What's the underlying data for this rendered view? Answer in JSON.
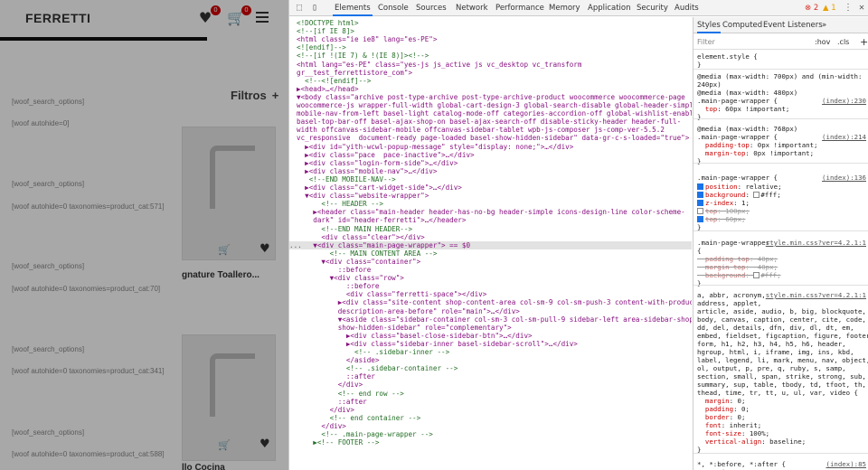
{
  "site": {
    "logo": "FERRETTI",
    "wishlist_badge": "0",
    "cart_badge": "0",
    "filters_label": "Filtros",
    "filters_plus": "+",
    "woof_lines": [
      "[woof_search_options]",
      "[woof autohide=0]",
      "[woof_search_options]",
      "[woof autohide=0 taxonomies=product_cat:571]",
      "[woof_search_options]",
      "[woof autohide=0 taxonomies=product_cat:70]",
      "[woof_search_options]",
      "[woof autohide=0 taxonomies=product_cat:341]",
      "[woof_search_options]",
      "[woof autohide=0 taxonomies=product_cat:588]"
    ],
    "product_names": [
      "gnature Toallero...",
      "llo Cocina"
    ]
  },
  "devtools": {
    "tabs": [
      "Elements",
      "Console",
      "Sources",
      "Network",
      "Performance",
      "Memory",
      "Application",
      "Security",
      "Audits"
    ],
    "active_tab": "Elements",
    "errors": "2",
    "warnings": "1",
    "styles_tabs": [
      "Styles",
      "Computed",
      "Event Listeners"
    ],
    "styles_more": "»",
    "filter_placeholder": "Filter",
    "hov": ":hov",
    "cls": ".cls",
    "add": "+",
    "selected_ellipsis": "...",
    "dom_lines": [
      "<!DOCTYPE html>",
      "<!--[if IE 8]>",
      "<html class=\"ie ie8\" lang=\"es-PE\">",
      "<![endif]-->",
      "<!--[if !(IE 7) & !(IE 8)]><!-->",
      "<html lang=\"es-PE\" class=\"yes-js js_active js vc_desktop vc_transform",
      "gr__test_ferrettistore_com\">",
      "  <!--<![endif]-->",
      "▶<head>…</head>",
      "▼<body class=\"archive post-type-archive post-type-archive-product woocommerce woocommerce-page",
      "woocommerce-js wrapper-full-width global-cart-design-3 global-search-disable global-header-simple",
      "mobile-nav-from-left basel-light catalog-mode-off categories-accordion-off global-wishlist-enable",
      "basel-top-bar-off basel-ajax-shop-on basel-ajax-search-off disable-sticky-header header-full-",
      "width offcanvas-sidebar-mobile offcanvas-sidebar-tablet wpb-js-composer js-comp-ver-5.5.2",
      "vc_responsive  document-ready page-loaded basel-show-hidden-sidebar\" data-gr-c-s-loaded=\"true\">",
      "  ▶<div id=\"yith-wcwl-popup-message\" style=\"display: none;\">…</div>",
      "  ▶<div class=\"pace  pace-inactive\">…</div>",
      "  ▶<div class=\"login-form-side\">…</div>",
      "  ▶<div class=\"mobile-nav\">…</div>",
      "   <!--END MOBILE-NAV-->",
      "  ▶<div class=\"cart-widget-side\">…</div>",
      "  ▼<div class=\"website-wrapper\">",
      "      <!-- HEADER -->",
      "    ▶<header class=\"main-header header-has-no-bg header-simple icons-design-line color-scheme-",
      "    dark\" id=\"header-ferretti\">…</header>",
      "      <!--END MAIN HEADER-->",
      "      <div class=\"clear\"></div>",
      "    ▼<div class=\"main-page-wrapper\"> == $0",
      "        <!-- MAIN CONTENT AREA -->",
      "      ▼<div class=\"container\">",
      "          ::before",
      "        ▼<div class=\"row\">",
      "            ::before",
      "            <div class=\"ferretti-space\"></div>",
      "          ▶<div class=\"site-content shop-content-area col-sm-9 col-sm-push-3 content-with-products",
      "          description-area-before\" role=\"main\">…</div>",
      "          ▼<aside class=\"sidebar-container col-sm-3 col-sm-pull-9 sidebar-left area-sidebar-shop",
      "          show-hidden-sidebar\" role=\"complementary\">",
      "            ▶<div class=\"basel-close-sidebar-btn\">…</div>",
      "            ▶<div class=\"sidebar-inner basel-sidebar-scroll\">…</div>",
      "              <!-- .sidebar-inner -->",
      "            </aside>",
      "            <!-- .sidebar-container -->",
      "            ::after",
      "          </div>",
      "          <!-- end row -->",
      "          ::after",
      "        </div>",
      "        <!-- end container -->",
      "      </div>",
      "      <!-- .main-page-wrapper -->",
      "    ▶<!-- FOOTER -->"
    ],
    "styles_lines": [
      "element.style {",
      "}",
      "@media (max-width: 700px) and (min-width:",
      "240px)",
      "@media (max-width: 480px)",
      ".main-page-wrapper {",
      "  top: 60px !important;",
      "}",
      "@media (max-width: 768px)",
      ".main-page-wrapper {",
      "  padding-top: 0px !important;",
      "  margin-top: 0px !important;",
      "}",
      ".main-page-wrapper {",
      "position: relative;",
      "background: ",
      "#fff;",
      "z-index: 1;",
      "top: 100px;",
      "top: 60px;",
      "}",
      ".main-page-wrapper",
      "{",
      "  padding-top: 40px;",
      "  margin-top: -40px;",
      "  background: ",
      "#fff;",
      "}",
      "a, abbr, acronym,",
      "address, applet,",
      "article, aside, audio, b, big, blockquote,",
      "body, canvas, caption, center, cite, code,",
      "dd, del, details, dfn, div, dl, dt, em,",
      "embed, fieldset, figcaption, figure, footer,",
      "form, h1, h2, h3, h4, h5, h6, header,",
      "hgroup, html, i, iframe, img, ins, kbd,",
      "label, legend, li, mark, menu, nav, object,",
      "ol, output, p, pre, q, ruby, s, samp,",
      "section, small, span, strike, strong, sub,",
      "summary, sup, table, tbody, td, tfoot, th,",
      "thead, time, tr, tt, u, ul, var, video {",
      "  margin: 0;",
      "  padding: 0;",
      "  border: 0;",
      "  font: inherit;",
      "  font-size: 100%;",
      "  vertical-align: baseline;",
      "}",
      "*, *:before, *:after {",
      "  margin: 0;"
    ],
    "sources": [
      "(index):230",
      "(index):214",
      "(index):136",
      "style.min.css?ver=4.2.1:1",
      "style.min.css?ver=4.2.1:1",
      "(index):85"
    ]
  }
}
